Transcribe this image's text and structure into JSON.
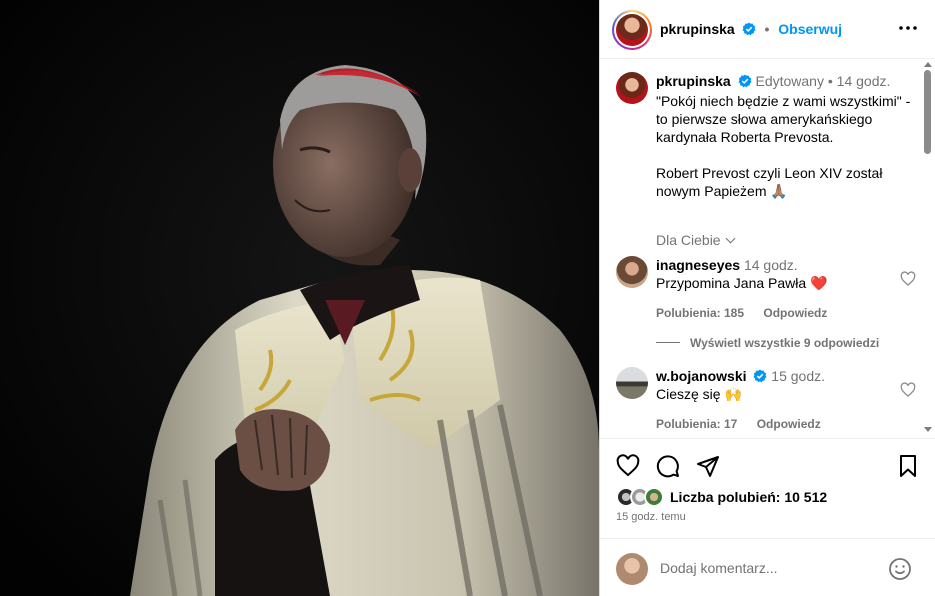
{
  "post": {
    "author": "pkrupinska",
    "follow_label": "Obserwuj",
    "dot": "•"
  },
  "caption": {
    "author": "pkrupinska",
    "edited": "Edytowany",
    "time": "14 godz.",
    "text": "\"Pokój niech będzie z wami wszystkimi\" - to pierwsze słowa amerykańskiego kardynała Roberta Prevosta.\n\nRobert Prevost czyli Leon XIV został nowym Papieżem 🙏🏽",
    "dla_ciebie": "Dla Ciebie"
  },
  "comments": [
    {
      "author": "inagneseyes",
      "time": "14 godz.",
      "text": "Przypomina Jana Pawła ❤️",
      "likes": "Polubienia: 185",
      "reply": "Odpowiedz",
      "verified": false
    },
    {
      "author": "w.bojanowski",
      "time": "15 godz.",
      "text": "Cieszę się 🙌",
      "likes": "Polubienia: 17",
      "reply": "Odpowiedz",
      "verified": true
    }
  ],
  "view_replies": "Wyświetl wszystkie 9 odpowiedzi",
  "likes_count": "Liczba polubień: 10 512",
  "posted_ago": "15 godz. temu",
  "add_comment": {
    "placeholder": "Dodaj komentarz..."
  },
  "colors": {
    "accent": "#0095f6",
    "verified": "#0095f6",
    "muted": "#737373",
    "heart": "#ed4956"
  },
  "icons": [
    "verified-badge-icon",
    "more-options-icon",
    "heart-icon",
    "comment-icon",
    "share-icon",
    "bookmark-icon",
    "emoji-icon",
    "chevron-down-icon"
  ]
}
